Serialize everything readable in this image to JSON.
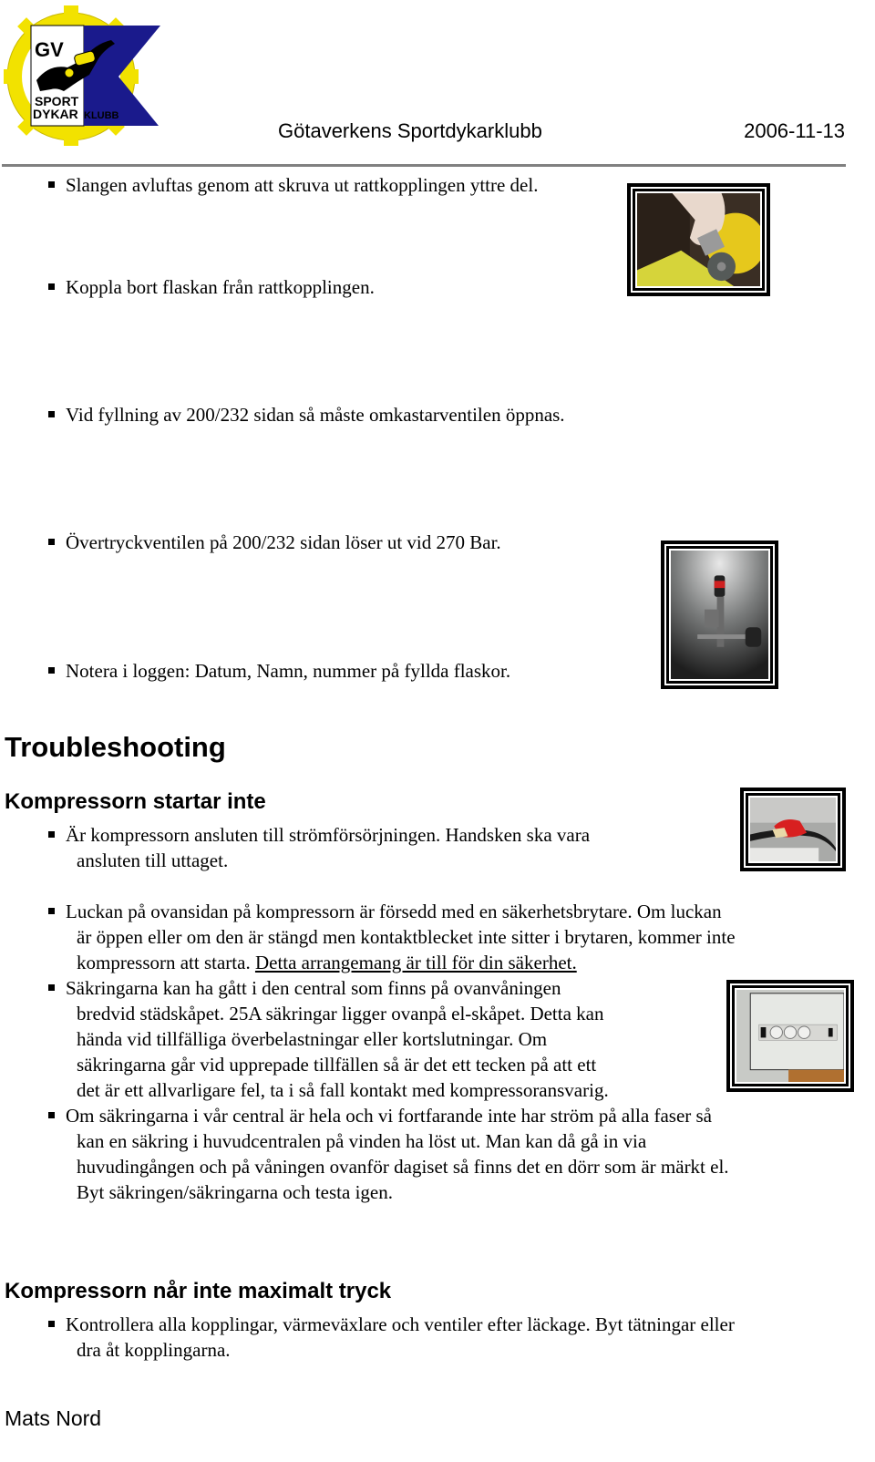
{
  "header": {
    "logo": {
      "icon": "club-logo-diver-flag",
      "text_top": "GV",
      "text_bottom_1": "SPORT",
      "text_bottom_2": "DYKAR",
      "text_bottom_3": "KLUBB",
      "colors": {
        "gear": "#f2e200",
        "flag_blue": "#1a1a8c",
        "flag_white": "#ffffff"
      }
    },
    "organization": "Götaverkens Sportdykarklubb",
    "date": "2006-11-13"
  },
  "procedure_items": [
    "Slangen avluftas genom att skruva ut rattkopplingen yttre del.",
    "Koppla bort flaskan från rattkopplingen.",
    "Vid fyllning av 200/232 sidan så måste omkastarventilen öppnas.",
    "Övertryckventilen på 200/232 sidan löser ut vid 270 Bar.",
    "Notera i loggen: Datum, Namn, nummer på fyllda flaskor."
  ],
  "photos": [
    {
      "name": "photo-tank-valve",
      "description": "hand unscrewing coupling on yellow tank"
    },
    {
      "name": "photo-overpressure-valve",
      "description": "overpressure valve with red cap on wall"
    },
    {
      "name": "photo-power-plug",
      "description": "red power plug connected"
    },
    {
      "name": "photo-fuse-box",
      "description": "electrical fuse panel"
    }
  ],
  "troubleshooting": {
    "title": "Troubleshooting",
    "sections": [
      {
        "heading": "Kompressorn startar inte",
        "items": [
          {
            "lines": [
              "Är kompressorn ansluten till strömförsörjningen. Handsken ska vara",
              "ansluten till uttaget."
            ]
          },
          {
            "lines": [
              "Luckan på ovansidan på kompressorn är försedd med en säkerhetsbrytare. Om luckan",
              "är öppen eller om den är stängd men kontaktblecket inte sitter i brytaren, kommer inte",
              "kompressorn att starta. "
            ],
            "underlined": "Detta arrangemang är till för din säkerhet."
          },
          {
            "lines": [
              "Säkringarna kan ha gått i den central som finns på ovanvåningen",
              "bredvid städskåpet. 25A säkringar ligger ovanpå el-skåpet. Detta kan",
              "hända vid tillfälliga överbelastningar eller kortslutningar. Om",
              "säkringarna går vid upprepade tillfällen så är det ett tecken på att ett",
              "det är ett allvarligare fel, ta i så fall kontakt med kompressoransvarig."
            ]
          },
          {
            "lines": [
              "Om säkringarna i vår central är hela och vi fortfarande inte har ström på alla faser så",
              "kan en säkring i huvudcentralen på vinden ha löst ut. Man kan då gå in via",
              "huvudingången och på våningen ovanför dagiset så finns det en dörr som är märkt el.",
              "Byt säkringen/säkringarna och testa igen."
            ]
          }
        ]
      },
      {
        "heading": "Kompressorn når inte maximalt tryck",
        "items": [
          {
            "lines": [
              "Kontrollera alla kopplingar, värmeväxlare och ventiler efter läckage. Byt tätningar eller",
              "dra åt kopplingarna."
            ]
          }
        ]
      }
    ]
  },
  "footer": {
    "author": "Mats Nord"
  }
}
